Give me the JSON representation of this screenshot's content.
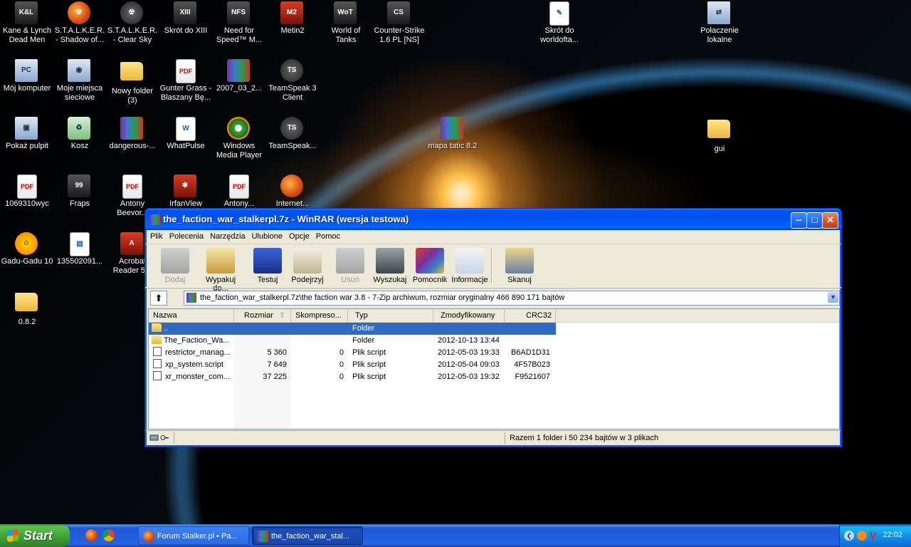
{
  "desktop": {
    "icons": [
      {
        "label": "Kane & Lynch\nDead Men",
        "glyph": "K&L",
        "icon": "kane-lynch-icon"
      },
      {
        "label": "S.T.A.L.K.E.R.\n- Shadow of...",
        "glyph": "☢",
        "icon": "stalker-icon"
      },
      {
        "label": "S.T.A.L.K.E.R.\n- Clear Sky",
        "glyph": "☢",
        "icon": "stalker-cs-icon"
      },
      {
        "label": "Skrót do XIII",
        "glyph": "XIII",
        "icon": "xiii-icon"
      },
      {
        "label": "Need for\nSpeed™ M...",
        "glyph": "NFS",
        "icon": "nfs-icon"
      },
      {
        "label": "Metin2",
        "glyph": "M2",
        "icon": "metin2-icon"
      },
      {
        "label": "World of\nTanks",
        "glyph": "WoT",
        "icon": "wot-icon"
      },
      {
        "label": "Counter-Strike\n1.6 PL [NS]",
        "glyph": "CS",
        "icon": "cs-icon"
      },
      {
        "label": "Skrót do\nworldofta...",
        "glyph": "✎",
        "icon": "shortcut-doc-icon"
      },
      {
        "label": "Połaczenie\nlokalne",
        "glyph": "⇄",
        "icon": "network-connection-icon"
      },
      {
        "label": "Mój komputer",
        "glyph": "PC",
        "icon": "my-computer-icon"
      },
      {
        "label": "Moje miejsca\nsieciowe",
        "glyph": "◉",
        "icon": "network-places-icon"
      },
      {
        "label": "Nowy folder\n(3)",
        "glyph": "",
        "icon": "folder-icon"
      },
      {
        "label": "Gunter Grass -\nBlaszany Bę...",
        "glyph": "PDF",
        "icon": "pdf-icon"
      },
      {
        "label": "2007_03_2...",
        "glyph": "",
        "icon": "winrar-archive-icon"
      },
      {
        "label": "TeamSpeak 3\nClient",
        "glyph": "TS",
        "icon": "teamspeak-icon"
      },
      {
        "label": "Pokaż pulpit",
        "glyph": "▣",
        "icon": "show-desktop-icon"
      },
      {
        "label": "Kosz",
        "glyph": "♻",
        "icon": "recycle-bin-icon"
      },
      {
        "label": "dangerous-...",
        "glyph": "",
        "icon": "winrar-archive-icon"
      },
      {
        "label": "WhatPulse",
        "glyph": "W",
        "icon": "whatpulse-icon"
      },
      {
        "label": "Windows\nMedia Player",
        "glyph": "▶",
        "icon": "media-player-icon"
      },
      {
        "label": "TeamSpeak...",
        "glyph": "TS",
        "icon": "teamspeak-icon"
      },
      {
        "label": "mapa tatic 8.2",
        "glyph": "",
        "icon": "winrar-archive-icon"
      },
      {
        "label": "gui",
        "glyph": "",
        "icon": "folder-icon"
      },
      {
        "label": "1069310wyc",
        "glyph": "PDF",
        "icon": "pdf-icon"
      },
      {
        "label": "Fraps",
        "glyph": "99",
        "icon": "fraps-icon"
      },
      {
        "label": "Antony\nBeevor...",
        "glyph": "PDF",
        "icon": "pdf-icon"
      },
      {
        "label": "IrfanView",
        "glyph": "✱",
        "icon": "irfanview-icon"
      },
      {
        "label": "Antony...",
        "glyph": "PDF",
        "icon": "pdf-icon"
      },
      {
        "label": "Internet...",
        "glyph": "",
        "icon": "firefox-icon"
      },
      {
        "label": "Gadu-Gadu 10",
        "glyph": "☺",
        "icon": "gadu-gadu-icon"
      },
      {
        "label": "135502091...",
        "glyph": "▤",
        "icon": "image-file-icon"
      },
      {
        "label": "Acrobat\nReader 5.0",
        "glyph": "A",
        "icon": "acrobat-icon"
      },
      {
        "label": "0.8.2",
        "glyph": "",
        "icon": "folder-icon"
      }
    ]
  },
  "winrar": {
    "title": "the_faction_war_stalkerpl.7z - WinRAR (wersja testowa)",
    "menu": [
      "Plik",
      "Polecenia",
      "Narzędzia",
      "Ulubione",
      "Opcje",
      "Pomoc"
    ],
    "toolbar": [
      {
        "label": "Dodaj",
        "icon": "add-icon",
        "disabled": true
      },
      {
        "label": "Wypakuj do...",
        "icon": "extract-icon",
        "disabled": false
      },
      {
        "label": "Testuj",
        "icon": "test-icon",
        "disabled": false
      },
      {
        "label": "Podejrzyj",
        "icon": "view-icon",
        "disabled": false
      },
      {
        "label": "Usuń",
        "icon": "delete-icon",
        "disabled": true
      },
      {
        "label": "Wyszukaj",
        "icon": "find-icon",
        "disabled": false
      },
      {
        "label": "Pomocnik",
        "icon": "wizard-icon",
        "disabled": false
      },
      {
        "label": "Informacje",
        "icon": "info-icon",
        "disabled": false
      },
      {
        "label": "Skanuj",
        "icon": "scan-icon",
        "disabled": false
      }
    ],
    "address": "the_faction_war_stalkerpl.7z\\the faction war 3.8 - 7-Zip archiwum, rozmiar oryginalny 466 890 171 bajtów",
    "columns": [
      "Nazwa",
      "Rozmiar",
      "Skompreso...",
      "Typ",
      "Zmodyfikowany",
      "CRC32"
    ],
    "rows": [
      {
        "name": "..",
        "size": "",
        "packed": "",
        "type": "Folder",
        "modified": "",
        "crc": "",
        "kind": "folder",
        "selected": true
      },
      {
        "name": "The_Faction_Wa...",
        "size": "",
        "packed": "",
        "type": "Folder",
        "modified": "2012-10-13 13:44",
        "crc": "",
        "kind": "folder",
        "selected": false
      },
      {
        "name": "restrictor_manag...",
        "size": "5 360",
        "packed": "0",
        "type": "Plik script",
        "modified": "2012-05-03 19:33",
        "crc": "B6AD1D31",
        "kind": "script",
        "selected": false
      },
      {
        "name": "xp_system.script",
        "size": "7 649",
        "packed": "0",
        "type": "Plik script",
        "modified": "2012-05-04 09:03",
        "crc": "4F57B023",
        "kind": "script",
        "selected": false
      },
      {
        "name": "xr_monster_com...",
        "size": "37 225",
        "packed": "0",
        "type": "Plik script",
        "modified": "2012-05-03 19:32",
        "crc": "F9521607",
        "kind": "script",
        "selected": false
      }
    ],
    "status": "Razem 1 folder i 50 234 bajtów w 3 plikach"
  },
  "taskbar": {
    "start": "Start",
    "tasks": [
      {
        "label": "Forum Stalker.pl • Pa...",
        "active": false,
        "icon": "firefox-icon"
      },
      {
        "label": "the_faction_war_stal...",
        "active": true,
        "icon": "winrar-icon"
      }
    ],
    "clock": "22:02"
  }
}
